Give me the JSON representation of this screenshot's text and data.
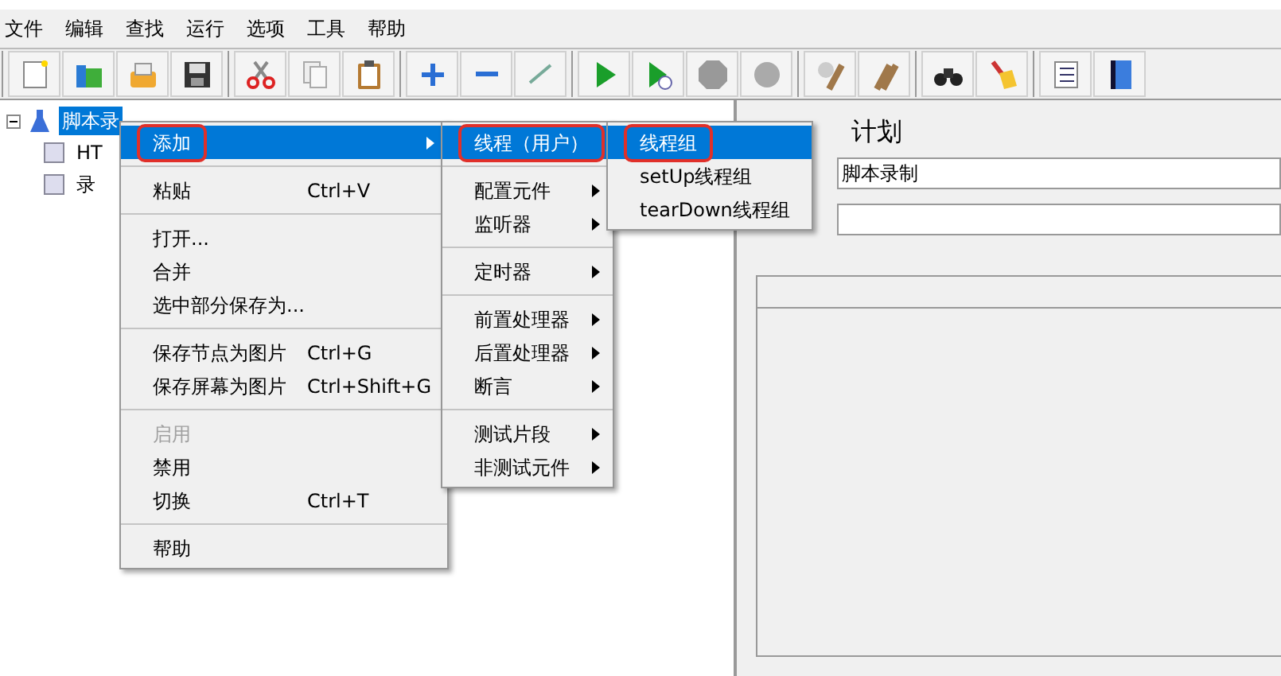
{
  "menubar": [
    "文件",
    "编辑",
    "查找",
    "运行",
    "选项",
    "工具",
    "帮助"
  ],
  "tree": [
    {
      "label": "脚本录",
      "selected": true,
      "expanded": true,
      "children": [
        {
          "label": "HT",
          "selected": false
        },
        {
          "label": "录",
          "selected": false
        }
      ]
    }
  ],
  "editor": {
    "title": "计划",
    "name_value": "脚本录制"
  },
  "context_menu": [
    {
      "kind": "item",
      "label": "添加",
      "submenu": true,
      "selected": true,
      "disabled": false,
      "marked": true
    },
    {
      "kind": "separator"
    },
    {
      "kind": "item",
      "label": "粘贴",
      "shortcut": "Ctrl+V",
      "selected": false,
      "disabled": false,
      "marked": false
    },
    {
      "kind": "separator"
    },
    {
      "kind": "item",
      "label": "打开...",
      "selected": false,
      "disabled": false,
      "marked": false
    },
    {
      "kind": "item",
      "label": "合并",
      "selected": false,
      "disabled": false,
      "marked": false
    },
    {
      "kind": "item",
      "label": "选中部分保存为...",
      "selected": false,
      "disabled": false,
      "marked": false
    },
    {
      "kind": "separator"
    },
    {
      "kind": "item",
      "label": "保存节点为图片",
      "shortcut": "Ctrl+G",
      "selected": false,
      "disabled": false,
      "marked": false
    },
    {
      "kind": "item",
      "label": "保存屏幕为图片",
      "shortcut": "Ctrl+Shift+G",
      "selected": false,
      "disabled": false,
      "marked": false
    },
    {
      "kind": "separator"
    },
    {
      "kind": "item",
      "label": "启用",
      "selected": false,
      "disabled": true,
      "marked": false
    },
    {
      "kind": "item",
      "label": "禁用",
      "selected": false,
      "disabled": false,
      "marked": false
    },
    {
      "kind": "item",
      "label": "切换",
      "shortcut": "Ctrl+T",
      "selected": false,
      "disabled": false,
      "marked": false
    },
    {
      "kind": "separator"
    },
    {
      "kind": "item",
      "label": "帮助",
      "selected": false,
      "disabled": false,
      "marked": false
    }
  ],
  "add_submenu": [
    {
      "kind": "item",
      "label": "线程（用户）",
      "submenu": true,
      "selected": true,
      "disabled": false,
      "marked": true
    },
    {
      "kind": "separator"
    },
    {
      "kind": "item",
      "label": "配置元件",
      "submenu": true,
      "selected": false,
      "disabled": false,
      "marked": false
    },
    {
      "kind": "item",
      "label": "监听器",
      "submenu": true,
      "selected": false,
      "disabled": false,
      "marked": false
    },
    {
      "kind": "separator"
    },
    {
      "kind": "item",
      "label": "定时器",
      "submenu": true,
      "selected": false,
      "disabled": false,
      "marked": false
    },
    {
      "kind": "separator"
    },
    {
      "kind": "item",
      "label": "前置处理器",
      "submenu": true,
      "selected": false,
      "disabled": false,
      "marked": false
    },
    {
      "kind": "item",
      "label": "后置处理器",
      "submenu": true,
      "selected": false,
      "disabled": false,
      "marked": false
    },
    {
      "kind": "item",
      "label": "断言",
      "submenu": true,
      "selected": false,
      "disabled": false,
      "marked": false
    },
    {
      "kind": "separator"
    },
    {
      "kind": "item",
      "label": "测试片段",
      "submenu": true,
      "selected": false,
      "disabled": false,
      "marked": false
    },
    {
      "kind": "item",
      "label": "非测试元件",
      "submenu": true,
      "selected": false,
      "disabled": false,
      "marked": false
    }
  ],
  "threads_submenu": [
    {
      "kind": "item",
      "label": "线程组",
      "selected": true,
      "disabled": false,
      "marked": true
    },
    {
      "kind": "item",
      "label": "setUp线程组",
      "selected": false,
      "disabled": false,
      "marked": false
    },
    {
      "kind": "item",
      "label": "tearDown线程组",
      "selected": false,
      "disabled": false,
      "marked": false
    }
  ]
}
